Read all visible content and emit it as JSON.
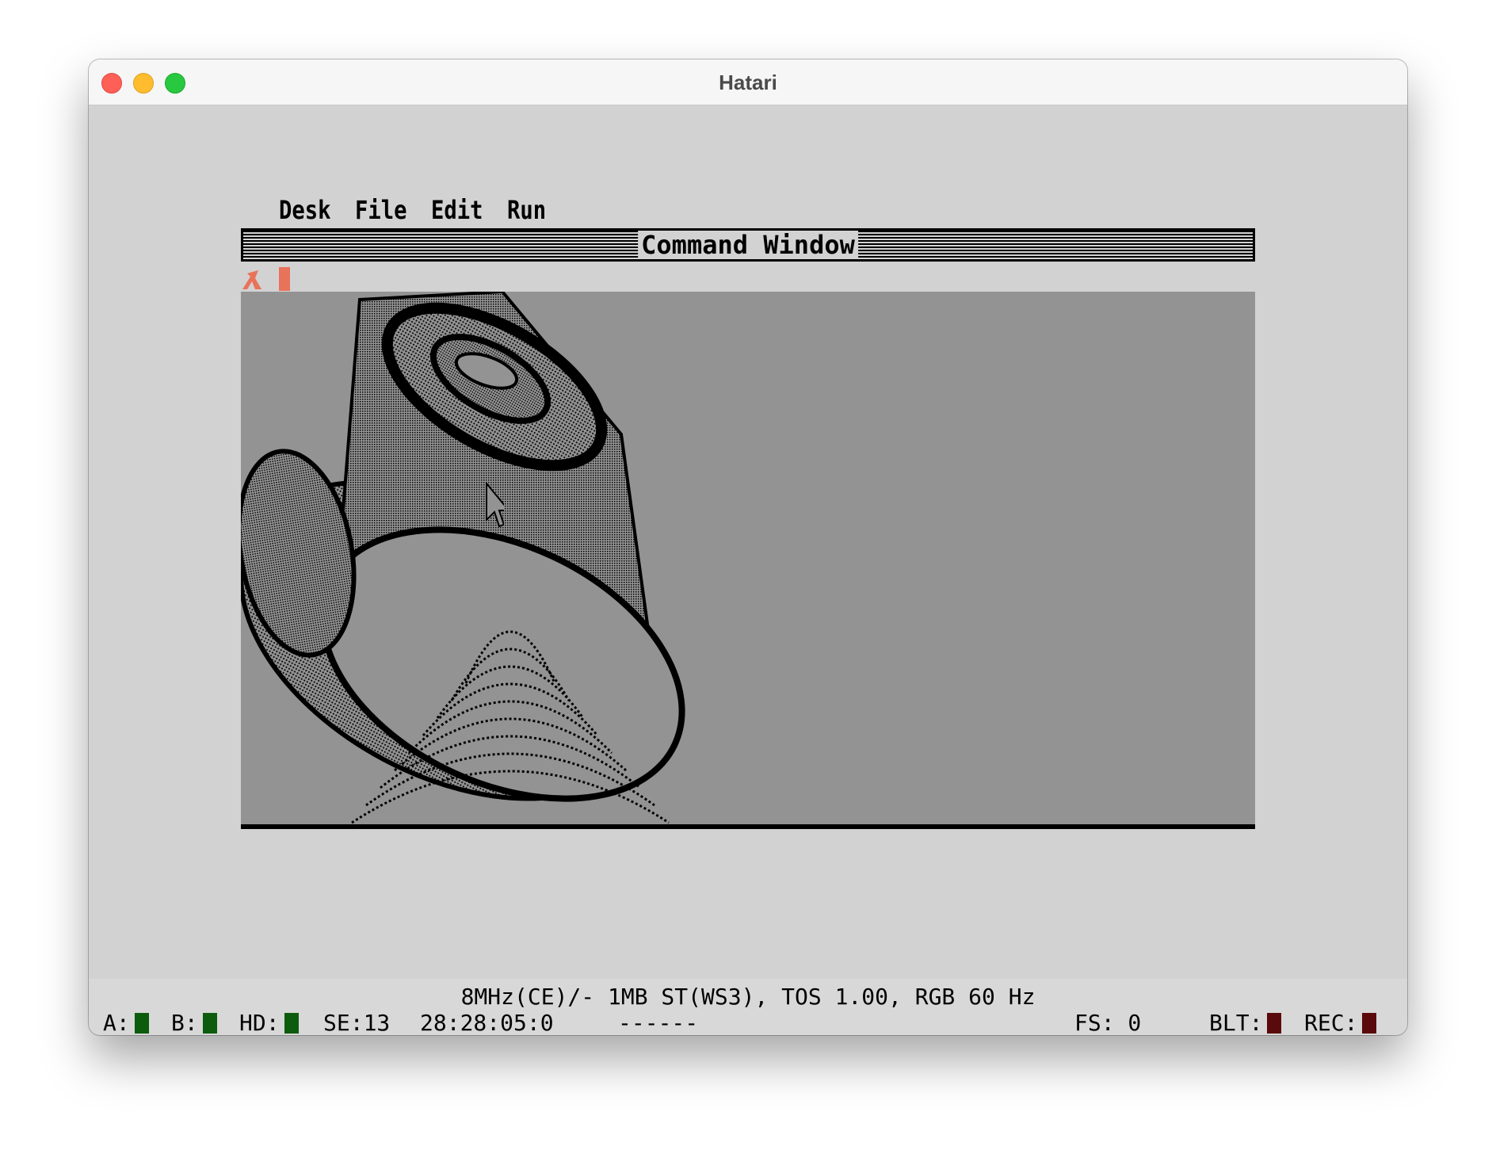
{
  "window": {
    "title": "Hatari"
  },
  "menubar": {
    "items": [
      "Desk",
      "File",
      "Edit",
      "Run"
    ]
  },
  "command_window": {
    "title": "Command Window"
  },
  "status": {
    "line1": "8MHz(CE)/- 1MB ST(WS3), TOS 1.00, RGB 60 Hz",
    "drive_a": "A:",
    "drive_b": "B:",
    "drive_hd": "HD:",
    "se": "SE:13",
    "time": "28:28:05:0",
    "dashes": "------",
    "fs": "FS: 0",
    "blt": "BLT:",
    "rec": "REC:"
  },
  "colors": {
    "led_on": "#0d5b0d",
    "led_off": "#5a0a0a",
    "canvas": "#939393",
    "accent_icon": "#e8735a"
  }
}
